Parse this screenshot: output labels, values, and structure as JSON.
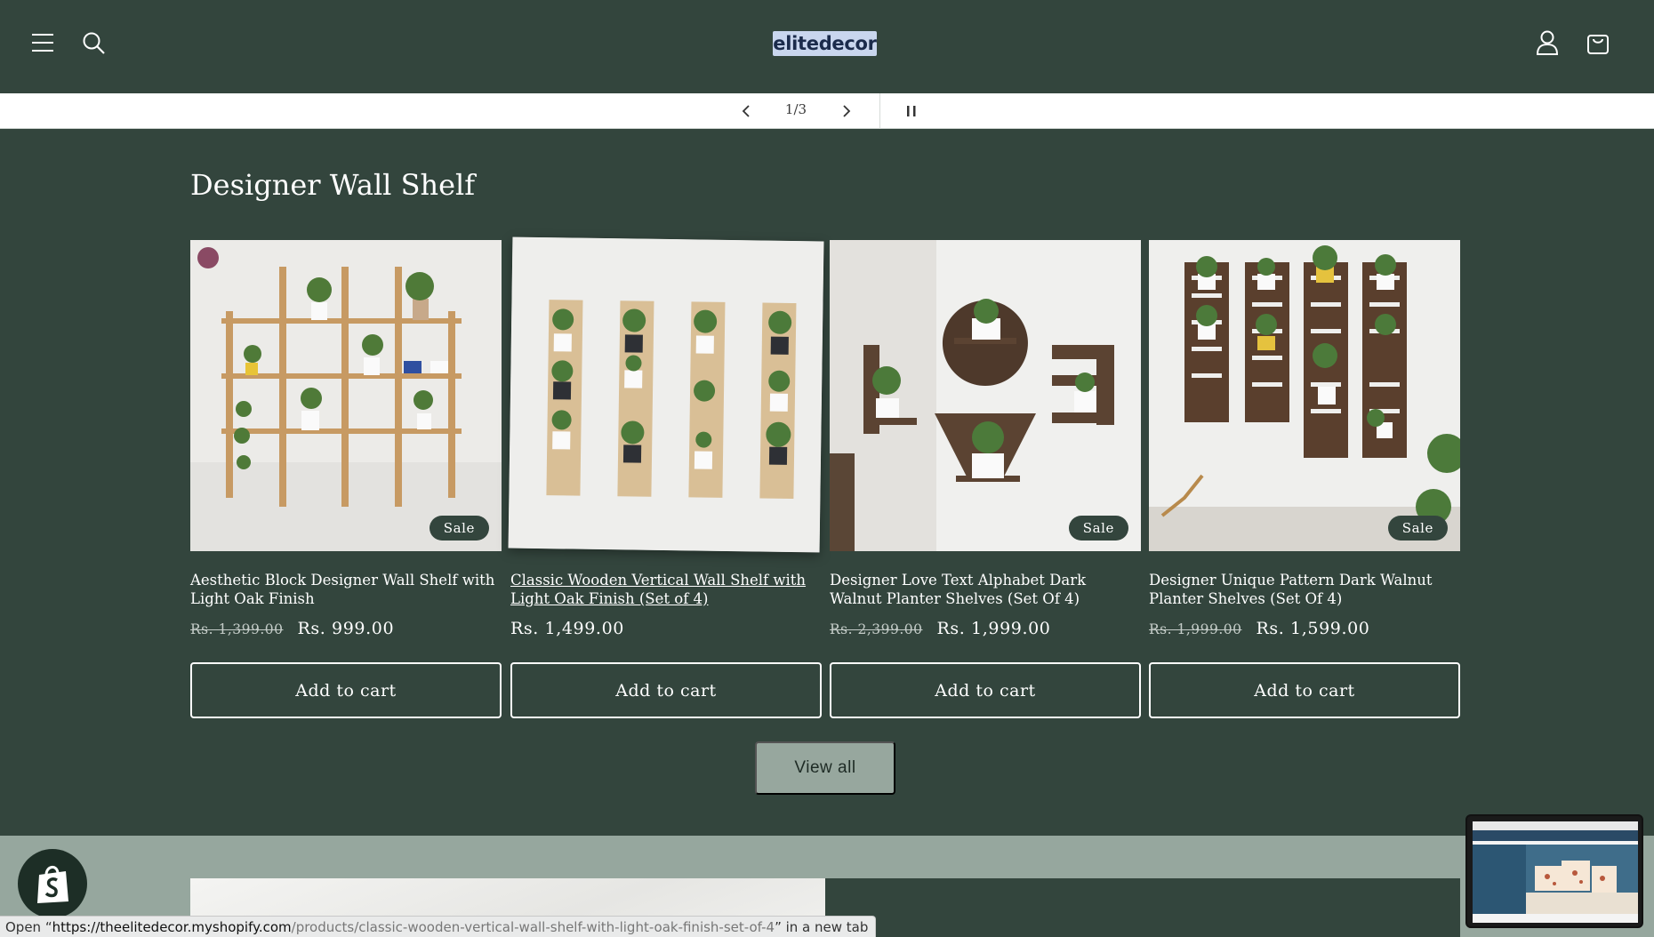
{
  "header": {
    "logo_text": "elitedecor",
    "menu_icon": "hamburger-menu-icon",
    "search_icon": "search-icon",
    "account_icon": "account-icon",
    "cart_icon": "cart-icon"
  },
  "announcement": {
    "counter": "1/3",
    "prev_icon": "chevron-left-icon",
    "next_icon": "chevron-right-icon",
    "pause_icon": "pause-icon"
  },
  "collection": {
    "title": "Designer Wall Shelf",
    "products": [
      {
        "title": "Aesthetic Block Designer Wall Shelf with Light Oak Finish",
        "old_price": "Rs. 1,399.00",
        "price": "Rs. 999.00",
        "badge": "Sale",
        "cta": "Add to cart"
      },
      {
        "title": "Classic Wooden Vertical Wall Shelf with Light Oak Finish (Set of 4)",
        "old_price": "",
        "price": "Rs. 1,499.00",
        "badge": "",
        "cta": "Add to cart"
      },
      {
        "title": "Designer Love Text Alphabet Dark Walnut Planter Shelves (Set Of 4)",
        "old_price": "Rs. 2,399.00",
        "price": "Rs. 1,999.00",
        "badge": "Sale",
        "cta": "Add to cart"
      },
      {
        "title": "Designer Unique Pattern Dark Walnut Planter Shelves (Set Of 4)",
        "old_price": "Rs. 1,999.00",
        "price": "Rs. 1,599.00",
        "badge": "Sale",
        "cta": "Add to cart"
      }
    ],
    "view_all": "View all"
  },
  "status_bar": {
    "prefix": "Open “",
    "host": "https://theelitedecor.myshopify.com",
    "path": "/products/classic-wooden-vertical-wall-shelf-with-light-oak-finish-set-of-4",
    "suffix": "” in a new tab"
  },
  "colors": {
    "background": "#33453d",
    "lower_band": "#96a79e",
    "view_all_button": "#97a79e"
  }
}
